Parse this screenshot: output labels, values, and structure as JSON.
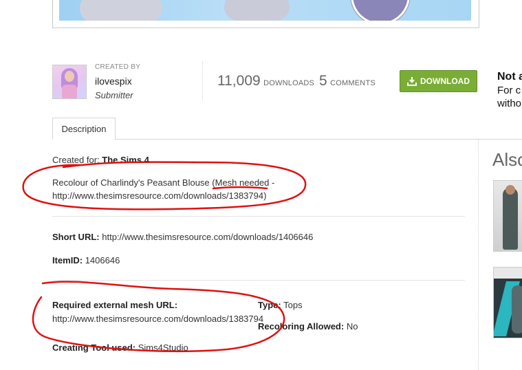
{
  "creator": {
    "created_by_label": "CREATED BY",
    "name": "ilovespix",
    "role": "Submitter"
  },
  "stats": {
    "downloads_count": "11,009",
    "downloads_label": "DOWNLOADS",
    "comments_count": "5",
    "comments_label": "COMMENTS"
  },
  "download_button": {
    "label": "DOWNLOAD",
    "icon": "download-icon",
    "color": "#7aad35"
  },
  "side_note": {
    "title": "Not a",
    "line1": "For c",
    "line2": "witho"
  },
  "tabs": [
    {
      "label": "Description"
    }
  ],
  "description": {
    "created_for_label": "Created for:",
    "created_for_value": "The Sims 4",
    "recolour_line1_start": "Recolour of Charlindy's Peasant Blouse (",
    "recolour_mesh_needed": "Mesh needed",
    "recolour_line1_end": " -",
    "recolour_line2": "http://www.thesimsresource.com/downloads/1383794)",
    "short_url_label": "Short URL:",
    "short_url_value": "http://www.thesimsresource.com/downloads/1406646",
    "item_id_label": "ItemID:",
    "item_id_value": "1406646",
    "required_mesh_label": "Required external mesh URL:",
    "required_mesh_value": "http://www.thesimsresource.com/downloads/1383794",
    "type_label": "Type:",
    "type_value": "Tops",
    "recoloring_label": "Recoloring Allowed:",
    "recoloring_value": "No",
    "creating_tool_label": "Creating Tool used:",
    "creating_tool_value": "Sims4Studio"
  },
  "also_section": {
    "title": "Also"
  },
  "annotation_color": "#e01010"
}
